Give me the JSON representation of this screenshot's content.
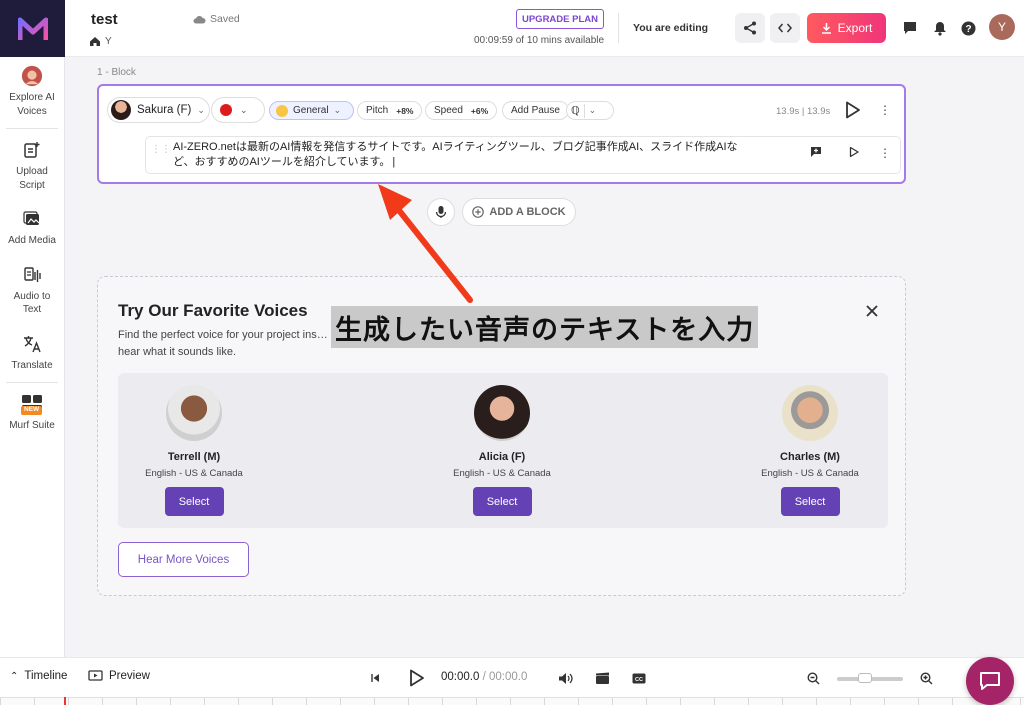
{
  "sidebar": {
    "items": [
      {
        "label": "Explore AI Voices",
        "icon": "voice-avatar-icon"
      },
      {
        "label": "Upload Script",
        "icon": "upload-script-icon"
      },
      {
        "label": "Add Media",
        "icon": "media-icon"
      },
      {
        "label": "Audio to Text",
        "icon": "audio-to-text-icon"
      },
      {
        "label": "Translate",
        "icon": "translate-icon"
      },
      {
        "label": "Murf Suite",
        "icon": "suite-icon",
        "badge": "NEW"
      }
    ]
  },
  "header": {
    "title": "test",
    "breadcrumb": "Y",
    "saved": "Saved",
    "upgrade": "UPGRADE PLAN",
    "time_left": "00:09:59 of 10 mins available",
    "editing": "You are editing",
    "export": "Export",
    "avatar": "Y",
    "colors": {
      "export_start": "#ff5a5f",
      "export_end": "#f0357a",
      "accent": "#7c45cf"
    }
  },
  "block": {
    "label": "1 -  Block",
    "voice": "Sakura (F)",
    "style": "General",
    "pitch_label": "Pitch",
    "pitch_value": "+8%",
    "speed_label": "Speed",
    "speed_value": "+6%",
    "add_pause": "Add Pause",
    "duration": "13.9s | 13.9s",
    "text": "AI-ZERO.netは最新のAI情報を発信するサイトです。AIライティングツール、ブログ記事作成AI、スライド作成AIなど、おすすめのAIツールを紹介しています。"
  },
  "add_block": "ADD A BLOCK",
  "annotation": "生成したい音声のテキストを入力",
  "favorites": {
    "title": "Try Our Favorite Voices",
    "description": "Find the perfect voice for your project ins… hear what it sounds like.",
    "voices": [
      {
        "name": "Terrell (M)",
        "lang": "English - US & Canada",
        "select": "Select"
      },
      {
        "name": "Alicia (F)",
        "lang": "English - US & Canada",
        "select": "Select"
      },
      {
        "name": "Charles (M)",
        "lang": "English - US & Canada",
        "select": "Select"
      }
    ],
    "hear_more": "Hear More Voices"
  },
  "bottom": {
    "timeline": "Timeline",
    "preview": "Preview",
    "time_current": "00:00.0",
    "time_total": "/ 00:00.0"
  }
}
